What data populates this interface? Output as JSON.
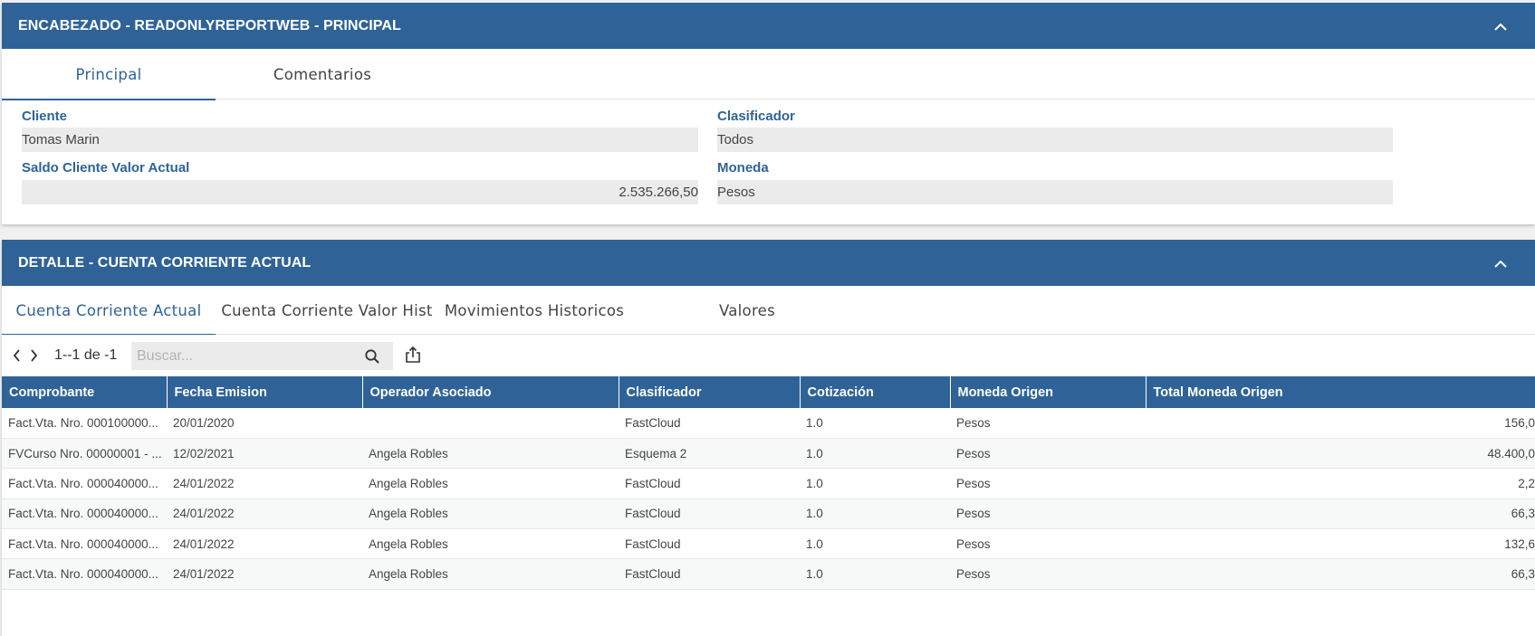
{
  "header_panel": {
    "title": "ENCABEZADO - READONLYREPORTWEB - PRINCIPAL",
    "tabs": [
      "Principal",
      "Comentarios"
    ],
    "active_tab": "Principal",
    "fields": {
      "cliente": {
        "label": "Cliente",
        "value": "Tomas Marin"
      },
      "clasificador": {
        "label": "Clasificador",
        "value": "Todos"
      },
      "saldo": {
        "label": "Saldo Cliente Valor Actual",
        "value": "2.535.266,50"
      },
      "moneda": {
        "label": "Moneda",
        "value": "Pesos"
      }
    }
  },
  "detail_panel": {
    "title": "DETALLE - CUENTA CORRIENTE ACTUAL",
    "tabs": [
      "Cuenta Corriente Actual",
      "Cuenta Corriente Valor Hist",
      "Movimientos Historicos",
      "Valores"
    ],
    "active_tab": "Cuenta Corriente Actual",
    "toolbar": {
      "pager": "1--1 de -1",
      "search_placeholder": "Buscar..."
    },
    "columns": [
      "Comprobante",
      "Fecha Emision",
      "Operador Asociado",
      "Clasificador",
      "Cotización",
      "Moneda Origen",
      "Total Moneda Origen"
    ],
    "rows": [
      [
        "Fact.Vta. Nro.  000100000...",
        "20/01/2020",
        "",
        "FastCloud",
        "1.0",
        "Pesos",
        "156,0"
      ],
      [
        "FVCurso Nro.  00000001 - ...",
        "12/02/2021",
        "Angela Robles",
        "Esquema 2",
        "1.0",
        "Pesos",
        "48.400,0"
      ],
      [
        "Fact.Vta. Nro.  000040000...",
        "24/01/2022",
        "Angela Robles",
        "FastCloud",
        "1.0",
        "Pesos",
        "2,2"
      ],
      [
        "Fact.Vta. Nro.  000040000...",
        "24/01/2022",
        "Angela Robles",
        "FastCloud",
        "1.0",
        "Pesos",
        "66,3"
      ],
      [
        "Fact.Vta. Nro.  000040000...",
        "24/01/2022",
        "Angela Robles",
        "FastCloud",
        "1.0",
        "Pesos",
        "132,6"
      ],
      [
        "Fact.Vta. Nro.  000040000...",
        "24/01/2022",
        "Angela Robles",
        "FastCloud",
        "1.0",
        "Pesos",
        "66,3"
      ]
    ]
  },
  "icons": {
    "collapse": "chevron-up-icon",
    "prev": "chevron-left-icon",
    "next": "chevron-right-icon",
    "search": "search-icon",
    "export": "share-icon"
  },
  "colors": {
    "header_bg": "#2f6398",
    "field_bg": "#ebebeb",
    "accent": "#2f6398"
  }
}
